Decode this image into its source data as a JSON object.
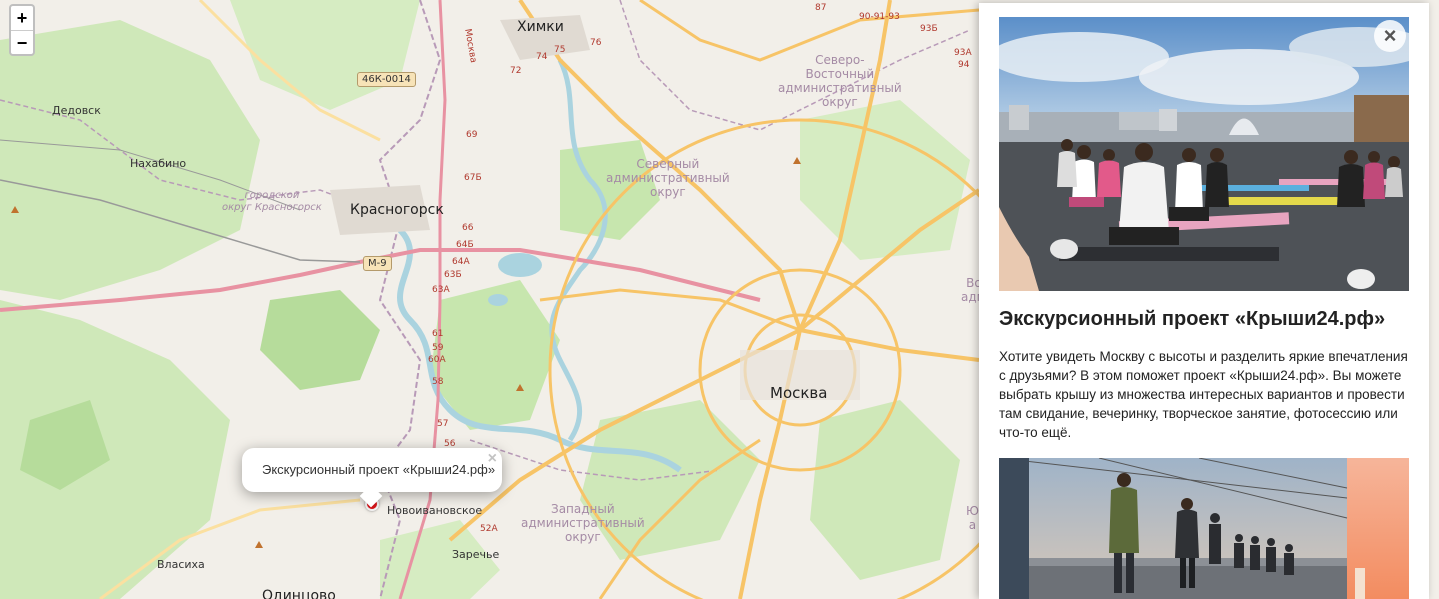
{
  "map": {
    "zoom_in_label": "+",
    "zoom_out_label": "−",
    "labels": {
      "khimki": "Химки",
      "dedovsk": "Дедовск",
      "nakhabino": "Нахабино",
      "krasnogorsk": "Красногорск",
      "krasnogorsk_district": "городской\nокруг Красногорск",
      "moskva": "Москва",
      "novoivanovskoe": "Новоивановское",
      "zarechye": "Заречье",
      "vlasikha": "Власиха",
      "odintsovo": "Одинцово",
      "north_district": "Северный\nадминистративный\nокруг",
      "ne_district": "Северо-\nВосточный\nадминистративный\nокруг",
      "west_district": "Западный\nадминистративный\nокруг",
      "east_partial": "Вос\nадми",
      "ug_partial": "Ю\nа"
    },
    "shields": {
      "r46k": "46К-0014",
      "m9": "М-9"
    },
    "km_markers": [
      "75",
      "76",
      "74",
      "72",
      "69",
      "67Б",
      "66",
      "64Б",
      "64А",
      "63Б",
      "63А",
      "61",
      "59",
      "60А",
      "58",
      "57",
      "56",
      "52А",
      "87",
      "90-91-93",
      "93Б",
      "93А",
      "94",
      "Москва"
    ]
  },
  "popup": {
    "text": "Экскурсионный проект «Крыши24.рф»",
    "close_label": "×"
  },
  "panel": {
    "close_label": "×",
    "title": "Экскурсионный проект «Крыши24.рф»",
    "description": "Хотите увидеть Москву с высоты и разделить яркие впечатления с друзьями? В этом поможет проект «Крыши24.рф». Вы можете выбрать крышу из множества интересных вариантов и провести там свидание, вечеринку, творческое занятие, фотосессию или что-то ещё."
  },
  "colors": {
    "marker": "#e8171d",
    "map_bg": "#f2efe9",
    "park": "#c8e5b0",
    "water": "#aad3df",
    "road_major": "#f7c467",
    "road_motorway": "#e892a2"
  }
}
